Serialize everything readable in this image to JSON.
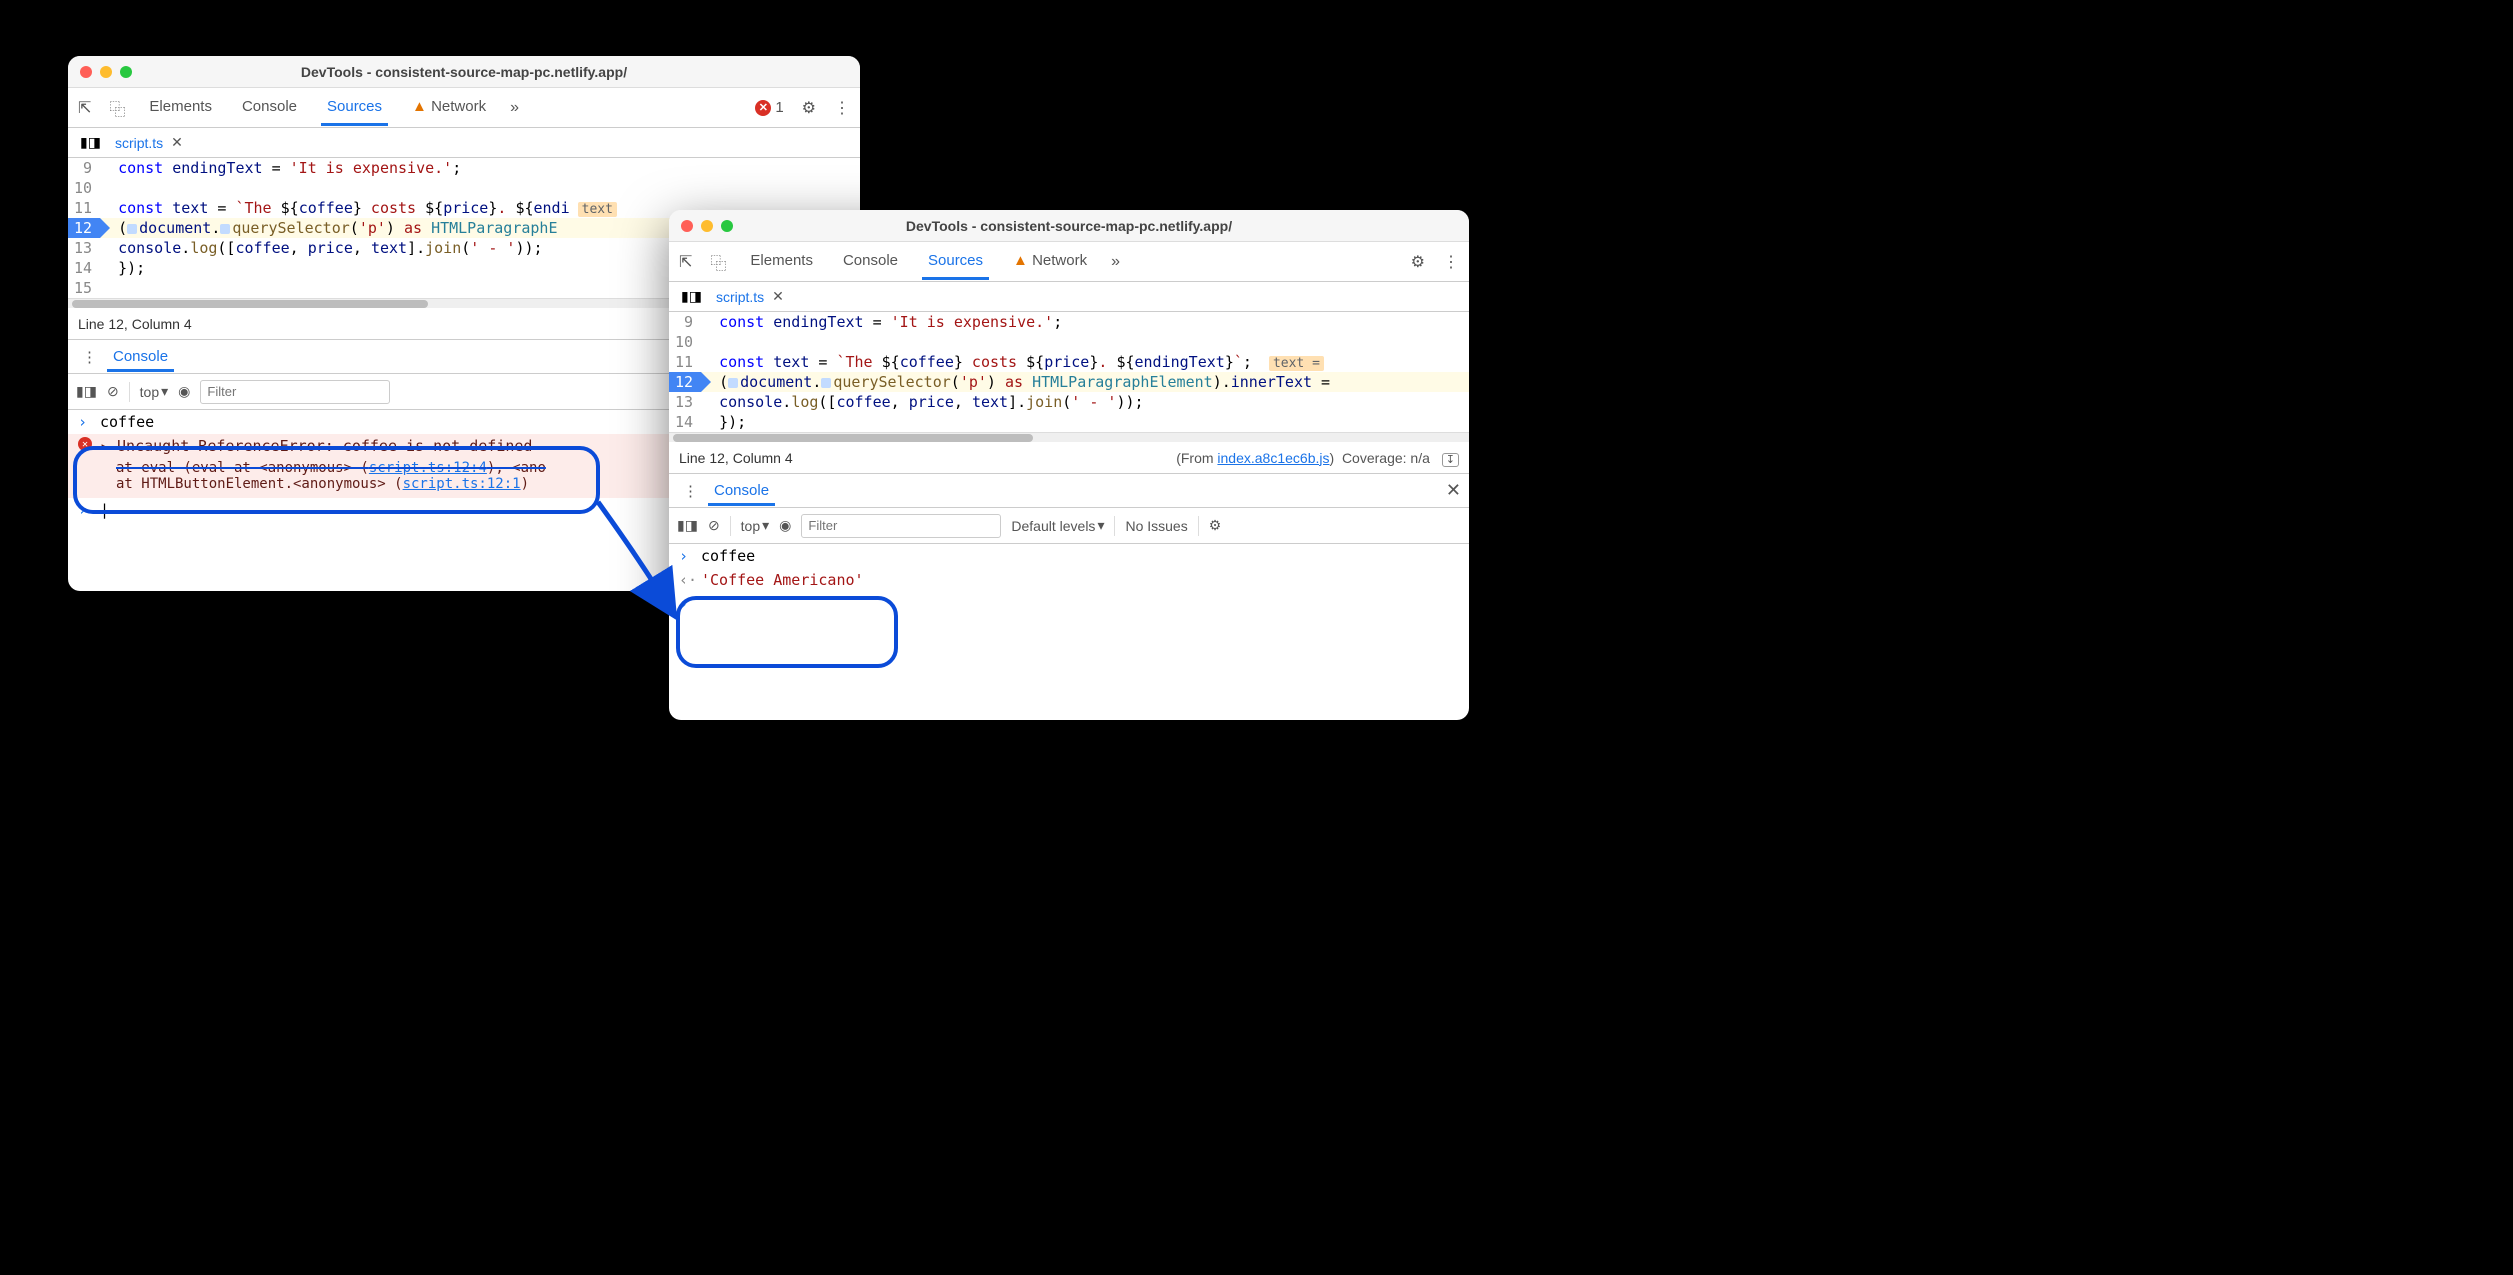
{
  "windowTitle": "DevTools - consistent-source-map-pc.netlify.app/",
  "tabs": {
    "elements": "Elements",
    "console": "Console",
    "sources": "Sources",
    "network": "Network"
  },
  "errorCount": "1",
  "fileTab": "script.ts",
  "w1": {
    "lines": [
      "9",
      "10",
      "11",
      "12",
      "13",
      "14",
      "15"
    ],
    "code9": "  const endingText = 'It is expensive.';",
    "code11": "  const text = `The ${coffee} costs ${price}. ${endi",
    "code11_overlay": "text",
    "code12_a": "(",
    "code12_doc": "document",
    "code12_dot": ".",
    "code12_qs": "querySelector",
    "code12_arg": "('p')",
    "code12_as": " as ",
    "code12_type": "HTMLParagraphE",
    "code13": "  console.log([coffee, price, text].join(' - '));",
    "code14": "});",
    "status": "Line 12, Column 4",
    "from": "(From ",
    "fromLink": "index.a8c1ec6b.js",
    "fromEnd": ")",
    "drawerTab": "Console",
    "ctx": "top",
    "filterPh": "Filter",
    "levels": "Default levels",
    "input": "coffee",
    "error": "Uncaught ReferenceError: coffee is not defined",
    "stack1a": "at eval (eval at <anonymous> (",
    "stack1link": "script.ts:12:4",
    "stack1b": "), <ano",
    "stack2a": "at HTMLButtonElement.<anonymous> (",
    "stack2link": "script.ts:12:1",
    "stack2b": ")"
  },
  "w2": {
    "lines": [
      "9",
      "10",
      "11",
      "12",
      "13",
      "14"
    ],
    "code9": "  const endingText = 'It is expensive.';",
    "code11": "  const text = `The ${coffee} costs ${price}. ${endingText}`;",
    "code11_overlay": "text =",
    "code12_a": "(",
    "code12_doc": "document",
    "code12_dot": ".",
    "code12_qs": "querySelector",
    "code12_arg": "('p')",
    "code12_as": " as ",
    "code12_type": "HTMLParagraphElement",
    "code12_rest": ").innerText =",
    "code13": "  console.log([coffee, price, text].join(' - '));",
    "code14": "});",
    "status": "Line 12, Column 4",
    "from": "(From ",
    "fromLink": "index.a8c1ec6b.js",
    "fromEnd": ")",
    "coverage": "Coverage: n/a",
    "drawerTab": "Console",
    "ctx": "top",
    "filterPh": "Filter",
    "levels": "Default levels",
    "noIssues": "No Issues",
    "input": "coffee",
    "output": "'Coffee Americano'"
  }
}
